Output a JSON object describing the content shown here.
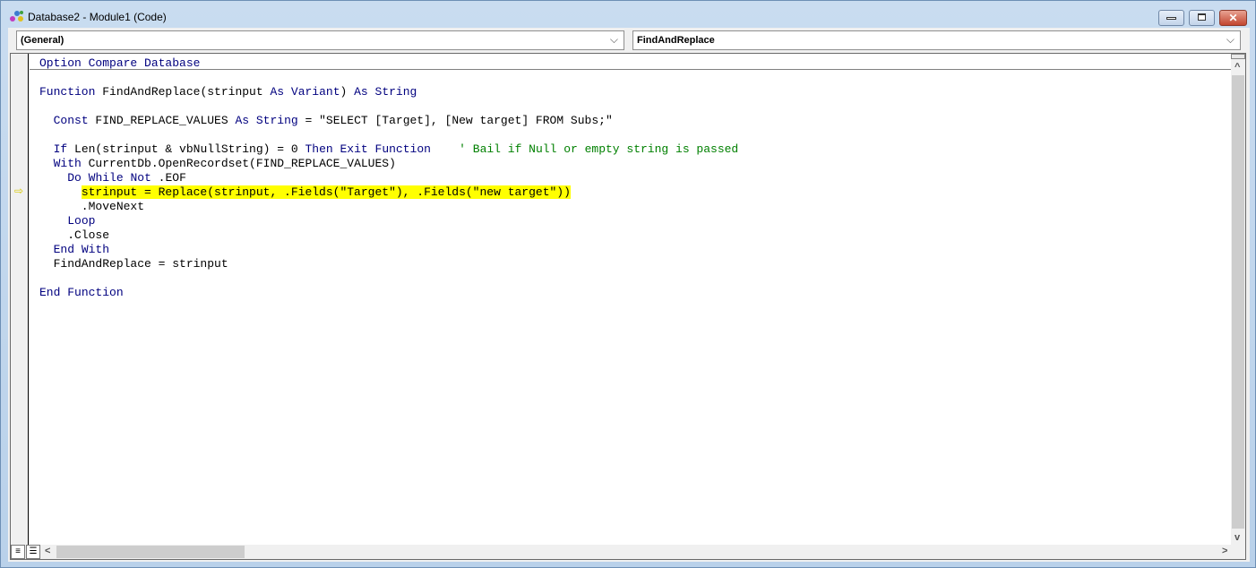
{
  "window": {
    "title": "Database2 - Module1 (Code)"
  },
  "object_combo": {
    "value": "(General)"
  },
  "procedure_combo": {
    "value": "FindAndReplace"
  },
  "code": {
    "lines": [
      [
        [
          "Option Compare Database",
          "kw"
        ]
      ],
      [],
      [
        [
          "Function",
          "kw"
        ],
        [
          " FindAndReplace(strinput ",
          ""
        ],
        [
          "As",
          "kw"
        ],
        [
          " ",
          ""
        ],
        [
          "Variant",
          "kw"
        ],
        [
          ") ",
          ""
        ],
        [
          "As",
          "kw"
        ],
        [
          " ",
          ""
        ],
        [
          "String",
          "kw"
        ]
      ],
      [],
      [
        [
          "  ",
          ""
        ],
        [
          "Const",
          "kw"
        ],
        [
          " FIND_REPLACE_VALUES ",
          ""
        ],
        [
          "As",
          "kw"
        ],
        [
          " ",
          ""
        ],
        [
          "String",
          "kw"
        ],
        [
          " = \"SELECT [Target], [New target] FROM Subs;\"",
          ""
        ]
      ],
      [],
      [
        [
          "  ",
          ""
        ],
        [
          "If",
          "kw"
        ],
        [
          " Len(strinput & vbNullString) = 0 ",
          ""
        ],
        [
          "Then",
          "kw"
        ],
        [
          " ",
          ""
        ],
        [
          "Exit",
          "kw"
        ],
        [
          " ",
          ""
        ],
        [
          "Function",
          "kw"
        ],
        [
          "    ",
          ""
        ],
        [
          "' Bail if Null or empty string is passed",
          "cm"
        ]
      ],
      [
        [
          "  ",
          ""
        ],
        [
          "With",
          "kw"
        ],
        [
          " CurrentDb.OpenRecordset(FIND_REPLACE_VALUES)",
          ""
        ]
      ],
      [
        [
          "    ",
          ""
        ],
        [
          "Do",
          "kw"
        ],
        [
          " ",
          ""
        ],
        [
          "While",
          "kw"
        ],
        [
          " ",
          ""
        ],
        [
          "Not",
          "kw"
        ],
        [
          " .EOF",
          ""
        ]
      ],
      [
        [
          "      ",
          ""
        ],
        [
          "strinput = Replace(strinput, .Fields(\"Target\"), .Fields(\"new target\"))",
          "hl"
        ]
      ],
      [
        [
          "      .MoveNext",
          ""
        ]
      ],
      [
        [
          "    ",
          ""
        ],
        [
          "Loop",
          "kw"
        ]
      ],
      [
        [
          "    .Close",
          ""
        ]
      ],
      [
        [
          "  ",
          ""
        ],
        [
          "End",
          "kw"
        ],
        [
          " ",
          ""
        ],
        [
          "With",
          "kw"
        ]
      ],
      [
        [
          "  FindAndReplace = strinput",
          ""
        ]
      ],
      [],
      [
        [
          "End",
          "kw"
        ],
        [
          " ",
          ""
        ],
        [
          "Function",
          "kw"
        ]
      ]
    ]
  }
}
